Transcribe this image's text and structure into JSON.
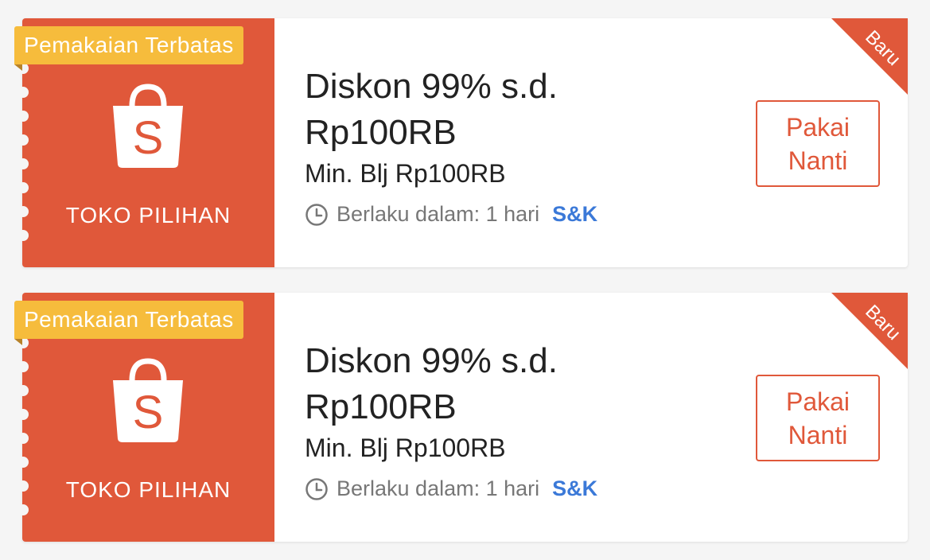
{
  "colors": {
    "brand": "#e0583a",
    "badge": "#f6bc3c",
    "link": "#3b79d8",
    "text": "#222222",
    "muted": "#777777"
  },
  "vouchers": [
    {
      "badge": "Pemakaian Terbatas",
      "store_label": "TOKO PILIHAN",
      "title": "Diskon 99% s.d. Rp100RB",
      "min_spend": "Min. Blj Rp100RB",
      "validity": "Berlaku dalam: 1 hari",
      "terms_link": "S&K",
      "action_line1": "Pakai",
      "action_line2": "Nanti",
      "ribbon": "Baru",
      "icon": "shopee-bag-icon"
    },
    {
      "badge": "Pemakaian Terbatas",
      "store_label": "TOKO PILIHAN",
      "title": "Diskon 99% s.d. Rp100RB",
      "min_spend": "Min. Blj Rp100RB",
      "validity": "Berlaku dalam: 1 hari",
      "terms_link": "S&K",
      "action_line1": "Pakai",
      "action_line2": "Nanti",
      "ribbon": "Baru",
      "icon": "shopee-bag-icon"
    }
  ]
}
